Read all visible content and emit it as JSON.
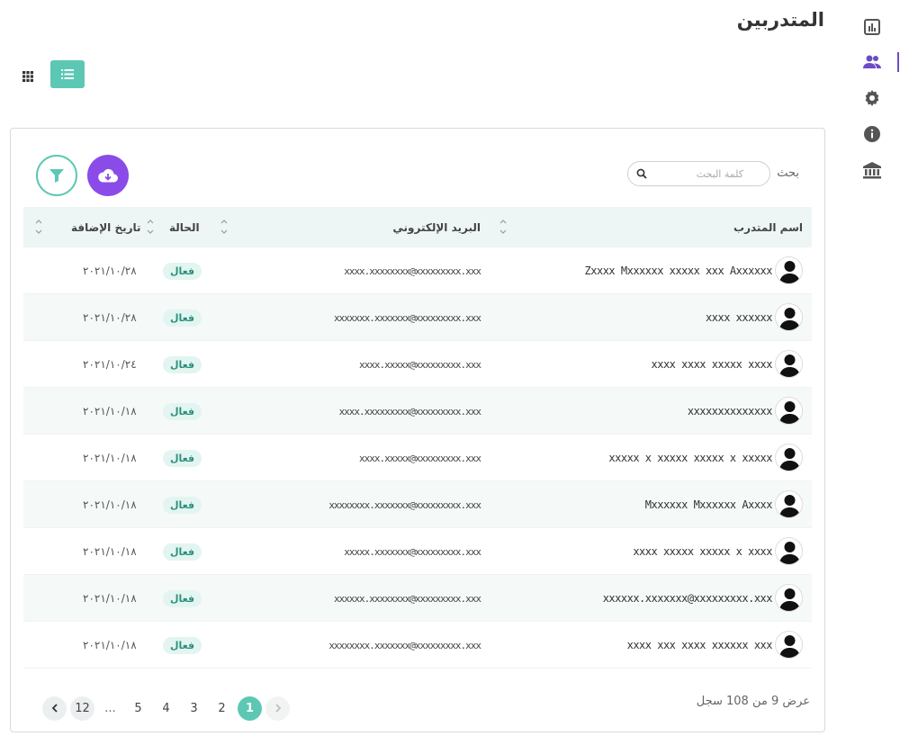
{
  "page": {
    "title": "المتدربين"
  },
  "sidebar": {
    "items": [
      {
        "name": "reports-icon",
        "active": false
      },
      {
        "name": "users-icon",
        "active": true
      },
      {
        "name": "gear-icon",
        "active": false
      },
      {
        "name": "info-icon",
        "active": false
      },
      {
        "name": "bank-icon",
        "active": false
      }
    ],
    "accent": "#6c4cc4"
  },
  "toolbar": {
    "search_label": "بحث",
    "search_placeholder": "كلمة البحث"
  },
  "table": {
    "headers": {
      "name": "اسم المتدرب",
      "email": "البريد الإلكتروني",
      "status": "الحالة",
      "date": "تاريخ الإضافة"
    },
    "rows": [
      {
        "name": "Zxxxx Mxxxxxx xxxxx xxx Axxxxxx",
        "email": "xxxx.xxxxxxxx@xxxxxxxxx.xxx",
        "status": "فعال",
        "date": "٢٠٢١/١٠/٢٨"
      },
      {
        "name": "xxxx xxxxxx",
        "email": "xxxxxxx.xxxxxxx@xxxxxxxxx.xxx",
        "status": "فعال",
        "date": "٢٠٢١/١٠/٢٨"
      },
      {
        "name": "xxxx xxxx xxxxx xxxx",
        "email": "xxxx.xxxxx@xxxxxxxxx.xxx",
        "status": "فعال",
        "date": "٢٠٢١/١٠/٢٤"
      },
      {
        "name": "xxxxxxxxxxxxxx",
        "email": "xxxx.xxxxxxxxx@xxxxxxxxx.xxx",
        "status": "فعال",
        "date": "٢٠٢١/١٠/١٨"
      },
      {
        "name": "xxxxx x xxxxx xxxxx x xxxxx",
        "email": "xxxx.xxxxx@xxxxxxxxx.xxx",
        "status": "فعال",
        "date": "٢٠٢١/١٠/١٨"
      },
      {
        "name": "Mxxxxxx Mxxxxxx Axxxx",
        "email": "xxxxxxxx.xxxxxxx@xxxxxxxxx.xxx",
        "status": "فعال",
        "date": "٢٠٢١/١٠/١٨"
      },
      {
        "name": "xxxx xxxxx xxxxx x xxxx",
        "email": "xxxxx.xxxxxxx@xxxxxxxxx.xxx",
        "status": "فعال",
        "date": "٢٠٢١/١٠/١٨"
      },
      {
        "name": "xxxxxx.xxxxxxx@xxxxxxxxx.xxx",
        "email": "xxxxxx.xxxxxxxx@xxxxxxxxx.xxx",
        "status": "فعال",
        "date": "٢٠٢١/١٠/١٨"
      },
      {
        "name": "xxxx xxx xxxx xxxxxx xxx",
        "email": "xxxxxxxx.xxxxxxx@xxxxxxxxx.xxx",
        "status": "فعال",
        "date": "٢٠٢١/١٠/١٨"
      }
    ]
  },
  "footer": {
    "record_count": "عرض 9 من 108 سجل",
    "pages": [
      "12",
      "...",
      "5",
      "4",
      "3",
      "2",
      "1"
    ],
    "current_page": "1"
  },
  "colors": {
    "primary": "#5cc8b4",
    "download": "#8a4be8"
  }
}
